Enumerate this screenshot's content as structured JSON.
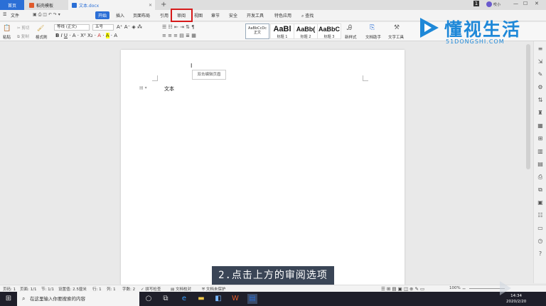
{
  "tabs": {
    "home": "首页",
    "tab1": "稻壳模板",
    "tab2": "文本.docx",
    "new_tab": "+"
  },
  "user": {
    "sync": "已同步",
    "name": "哎小"
  },
  "menu": {
    "file": "文件",
    "items": [
      "开始",
      "插入",
      "页面布局",
      "引用",
      "审阅",
      "视图",
      "章节",
      "安全",
      "开发工具",
      "特色应用"
    ],
    "search": "查找"
  },
  "ribbon": {
    "paste": "粘贴",
    "cut": "剪切",
    "copy": "复制",
    "format_painter": "格式刷",
    "font_name": "等线 (正文)",
    "font_size": "五号",
    "styles": [
      {
        "preview": "AaBbCcDc",
        "label": "正文"
      },
      {
        "preview": "AaBl",
        "label": "标题 1"
      },
      {
        "preview": "AaBb(",
        "label": "标题 2"
      },
      {
        "preview": "AaBbC",
        "label": "标题 3"
      }
    ],
    "new_style": "新样式",
    "text_assistant": "文档助手",
    "text_tools": "文字工具"
  },
  "document": {
    "tooltip": "双击编辑页眉",
    "body_text": "文本"
  },
  "caption": "2.点击上方的审阅选项",
  "logo": {
    "cn": "懂视生活",
    "en": "51DONGSHI.COM"
  },
  "status": {
    "page": "页码: 1",
    "pages": "页面: 1/1",
    "section": "节: 1/1",
    "setting": "设置值: 2.5厘米",
    "row": "行: 1",
    "col": "列: 1",
    "words": "字数: 2",
    "spell": "拼写检查",
    "compare": "文档校对",
    "protect": "文档未保护",
    "zoom": "100%"
  },
  "taskbar": {
    "search_placeholder": "在这里输入你要搜索的内容",
    "time": "14:34",
    "date": "2020/2/20"
  }
}
